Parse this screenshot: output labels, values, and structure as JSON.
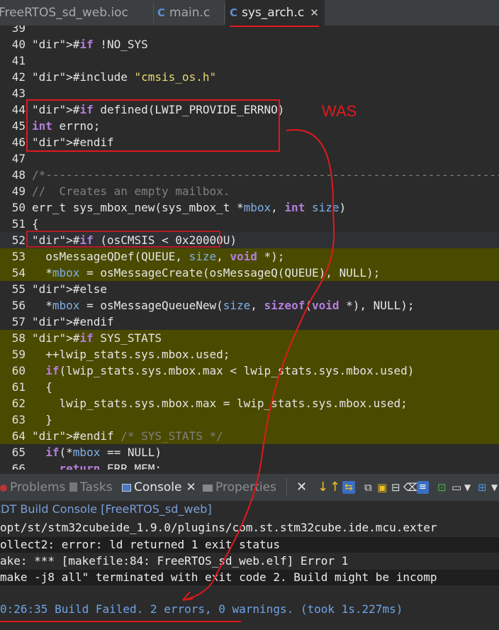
{
  "tabs": [
    {
      "label": "FreeRTOS_sd_web.ioc",
      "active": false
    },
    {
      "label": "main.c",
      "active": false
    },
    {
      "label": "sys_arch.c",
      "active": true
    }
  ],
  "tab_close_glyph": "✕",
  "tab_file_glyph": "C",
  "code_lines": [
    {
      "n": "39",
      "t": ""
    },
    {
      "n": "40",
      "t": "#if !NO_SYS"
    },
    {
      "n": "41",
      "t": ""
    },
    {
      "n": "42",
      "t": "#include \"cmsis_os.h\""
    },
    {
      "n": "43",
      "t": ""
    },
    {
      "n": "44",
      "t": "#if defined(LWIP_PROVIDE_ERRNO)"
    },
    {
      "n": "45",
      "t": "int errno;"
    },
    {
      "n": "46",
      "t": "#endif"
    },
    {
      "n": "47",
      "t": ""
    },
    {
      "n": "48",
      "t": "/*-----------------------------------------------------------------------------------"
    },
    {
      "n": "49",
      "t": "//  Creates an empty mailbox."
    },
    {
      "n": "50",
      "t": "err_t sys_mbox_new(sys_mbox_t *mbox, int size)"
    },
    {
      "n": "51",
      "t": "{"
    },
    {
      "n": "52",
      "t": "#if (osCMSIS < 0x20000U)"
    },
    {
      "n": "53",
      "t": "  osMessageQDef(QUEUE, size, void *);"
    },
    {
      "n": "54",
      "t": "  *mbox = osMessageCreate(osMessageQ(QUEUE), NULL);"
    },
    {
      "n": "55",
      "t": "#else"
    },
    {
      "n": "56",
      "t": "  *mbox = osMessageQueueNew(size, sizeof(void *), NULL);"
    },
    {
      "n": "57",
      "t": "#endif"
    },
    {
      "n": "58",
      "t": "#if SYS_STATS"
    },
    {
      "n": "59",
      "t": "  ++lwip_stats.sys.mbox.used;"
    },
    {
      "n": "60",
      "t": "  if(lwip_stats.sys.mbox.max < lwip_stats.sys.mbox.used)"
    },
    {
      "n": "61",
      "t": "  {"
    },
    {
      "n": "62",
      "t": "    lwip_stats.sys.mbox.max = lwip_stats.sys.mbox.used;"
    },
    {
      "n": "63",
      "t": "  }"
    },
    {
      "n": "64",
      "t": "#endif /* SYS_STATS */"
    },
    {
      "n": "65",
      "t": "  if(*mbox == NULL)"
    },
    {
      "n": "66",
      "t": "    return ERR_MEM;"
    }
  ],
  "annotation_text": "WAS",
  "panel_tabs": [
    "Problems",
    "Tasks",
    "Console",
    "Properties"
  ],
  "console_title": "CDT Build Console [FreeRTOS_sd_web]",
  "console_lines": [
    "opt/st/stm32cubeide_1.9.0/plugins/com.st.stm32cube.ide.mcu.exter",
    "ollect2: error: ld returned 1 exit status",
    "ake: *** [makefile:84: FreeRTOS_sd_web.elf] Error 1",
    "make -j8 all\" terminated with exit code 2. Build might be incomp",
    "",
    "0:26:35 Build Failed. 2 errors, 0 warnings. (took 1s.227ms)"
  ],
  "colors": {
    "annotation": "#e0191e",
    "highlight": "#4a4a00",
    "final_line": "#6ea4e8"
  }
}
